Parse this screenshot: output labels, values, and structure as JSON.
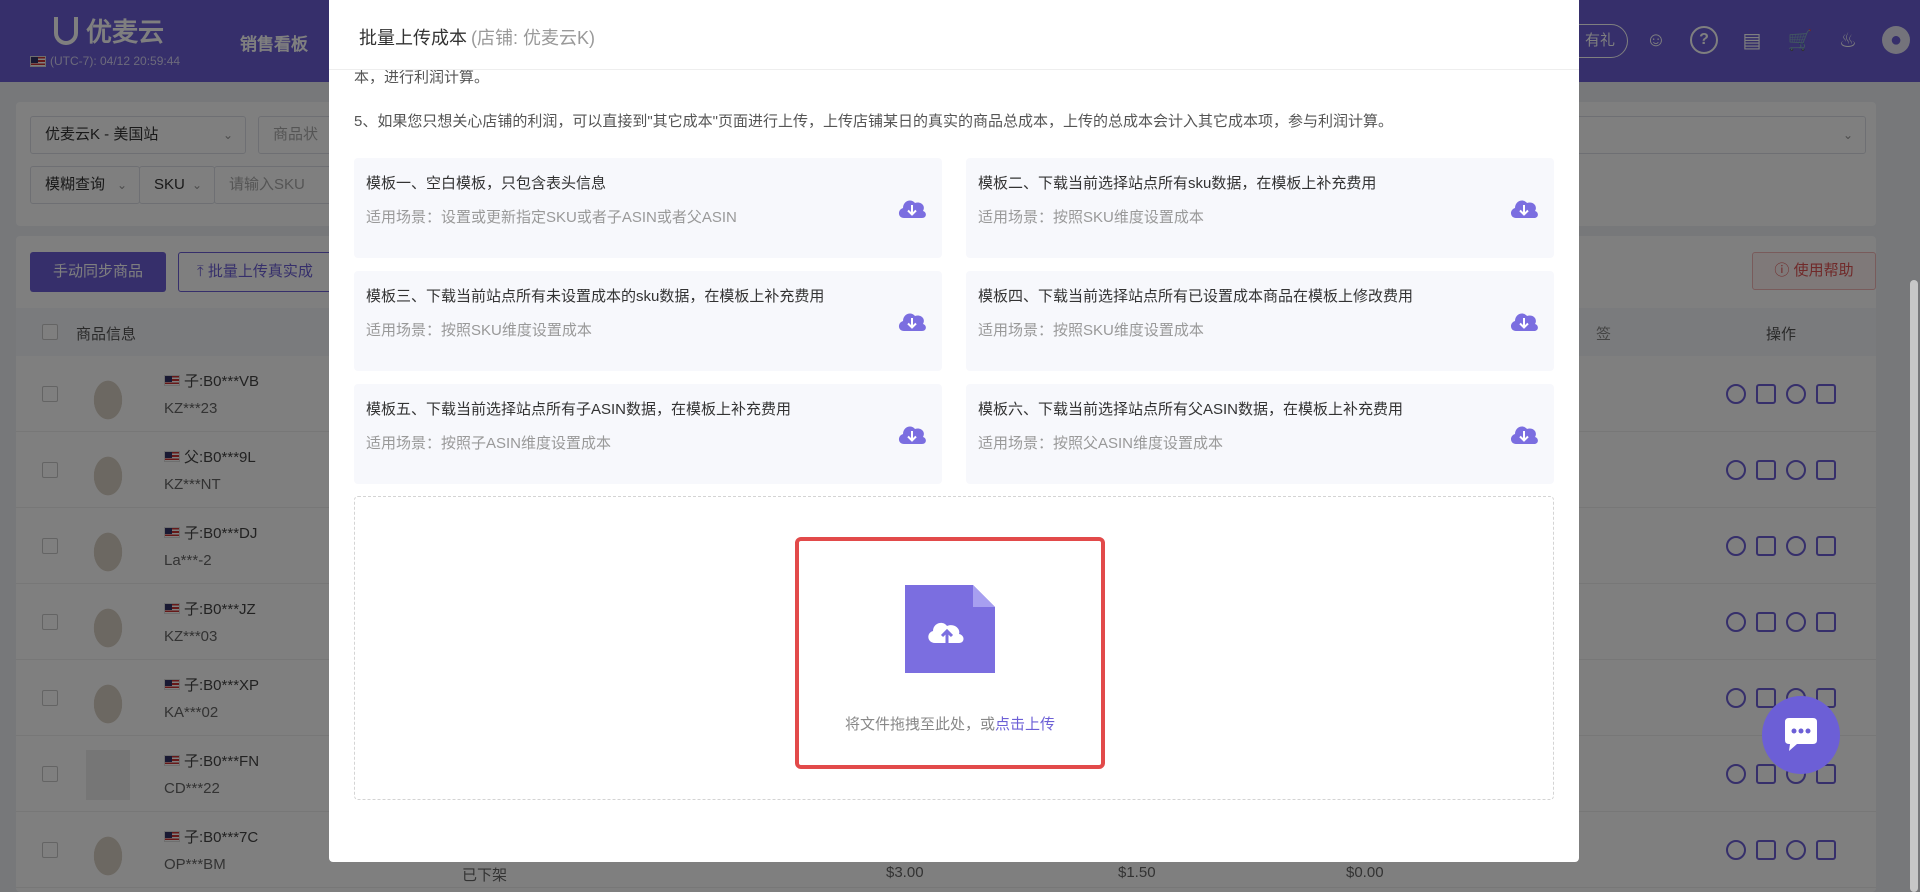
{
  "app": {
    "brand": "优麦云",
    "clock": "(UTC-7): 04/12 20:59:44",
    "nav_sales": "销售看板",
    "gift_label": "有礼"
  },
  "filters": {
    "store_select": "优麦云K - 美国站",
    "status_select": "商品状",
    "search_mode": "模糊查询",
    "field_select": "SKU",
    "search_placeholder": "请输入SKU"
  },
  "list": {
    "sync_button": "手动同步商品",
    "batch_upload_button": "批量上传真实成",
    "help_button": "使用帮助",
    "col_product_info": "商品信息",
    "col_tag": "签",
    "col_actions": "操作",
    "rows": [
      {
        "asin": "子:B0***VB",
        "sku": "KZ***23"
      },
      {
        "asin": "父:B0***9L",
        "sku": "KZ***NT"
      },
      {
        "asin": "子:B0***DJ",
        "sku": "La***-2"
      },
      {
        "asin": "子:B0***JZ",
        "sku": "KZ***03"
      },
      {
        "asin": "子:B0***XP",
        "sku": "KA***02"
      },
      {
        "asin": "子:B0***FN",
        "sku": "CD***22"
      },
      {
        "asin": "子:B0***7C",
        "sku": "OP***BM"
      }
    ],
    "last_row_status": "已下架",
    "last_row_price1": "$3.00",
    "last_row_price2": "$1.50",
    "last_row_price3": "$0.00"
  },
  "modal": {
    "title": "批量上传成本",
    "store": "(店铺: 优麦云K)",
    "note_cut": "本，进行利润计算。",
    "note5": "5、如果您只想关心店铺的利润，可以直接到\"其它成本\"页面进行上传，上传店铺某日的真实的商品总成本，上传的总成本会计入其它成本项，参与利润计算。",
    "templates": [
      {
        "title": "模板一、空白模板，只包含表头信息",
        "desc": "适用场景：设置或更新指定SKU或者子ASIN或者父ASIN"
      },
      {
        "title": "模板二、下载当前选择站点所有sku数据，在模板上补充费用",
        "desc": "适用场景：按照SKU维度设置成本"
      },
      {
        "title": "模板三、下载当前站点所有未设置成本的sku数据，在模板上补充费用",
        "desc": "适用场景：按照SKU维度设置成本"
      },
      {
        "title": "模板四、下载当前选择站点所有已设置成本商品在模板上修改费用",
        "desc": "适用场景：按照SKU维度设置成本"
      },
      {
        "title": "模板五、下载当前选择站点所有子ASIN数据，在模板上补充费用",
        "desc": "适用场景：按照子ASIN维度设置成本"
      },
      {
        "title": "模板六、下载当前选择站点所有父ASIN数据，在模板上补充费用",
        "desc": "适用场景：按照父ASIN维度设置成本"
      }
    ],
    "drop_text": "将文件拖拽至此处，或",
    "drop_link": "点击上传"
  },
  "colors": {
    "brand": "#6c5fd6",
    "highlight": "#e24a4a"
  }
}
